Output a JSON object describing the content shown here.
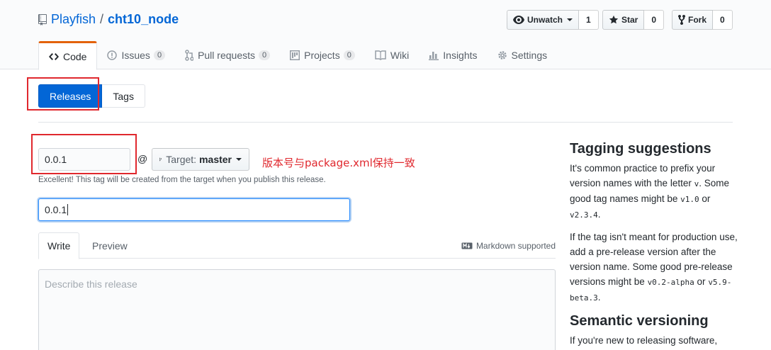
{
  "repo": {
    "owner": "Playfish",
    "separator": "/",
    "name": "cht10_node"
  },
  "actions": {
    "watch": {
      "label": "Unwatch",
      "count": "1"
    },
    "star": {
      "label": "Star",
      "count": "0"
    },
    "fork": {
      "label": "Fork",
      "count": "0"
    }
  },
  "nav_tabs": [
    {
      "label": "Code",
      "counter": null
    },
    {
      "label": "Issues",
      "counter": "0"
    },
    {
      "label": "Pull requests",
      "counter": "0"
    },
    {
      "label": "Projects",
      "counter": "0"
    },
    {
      "label": "Wiki",
      "counter": null
    },
    {
      "label": "Insights",
      "counter": null
    },
    {
      "label": "Settings",
      "counter": null
    }
  ],
  "subnav": {
    "releases": "Releases",
    "tags": "Tags"
  },
  "tag_input": {
    "value": "0.0.1"
  },
  "at_sign": "@",
  "target": {
    "prefix": "Target:",
    "branch": "master"
  },
  "annotation": "版本号与package.xml保持一致",
  "tag_note": "Excellent! This tag will be created from the target when you publish this release.",
  "title_input": {
    "value": "0.0.1"
  },
  "editor": {
    "write": "Write",
    "preview": "Preview",
    "markdown": "Markdown supported",
    "placeholder": "Describe this release"
  },
  "sidebar": {
    "heading1": "Tagging suggestions",
    "p1_a": "It's common practice to prefix your version names with the letter ",
    "p1_code1": "v",
    "p1_b": ". Some good tag names might be ",
    "p1_code2": "v1.0",
    "p1_c": " or ",
    "p1_code3": "v2.3.4",
    "p1_d": ".",
    "p2_a": "If the tag isn't meant for production use, add a pre-release version after the version name. Some good pre-release versions might be ",
    "p2_code1": "v0.2-alpha",
    "p2_b": " or ",
    "p2_code2": "v5.9-beta.3",
    "p2_c": ".",
    "heading2": "Semantic versioning",
    "p3": "If you're new to releasing software,"
  },
  "colors": {
    "primary": "#0366d6",
    "highlight": "#e0282e",
    "tab_accent": "#e36209"
  }
}
